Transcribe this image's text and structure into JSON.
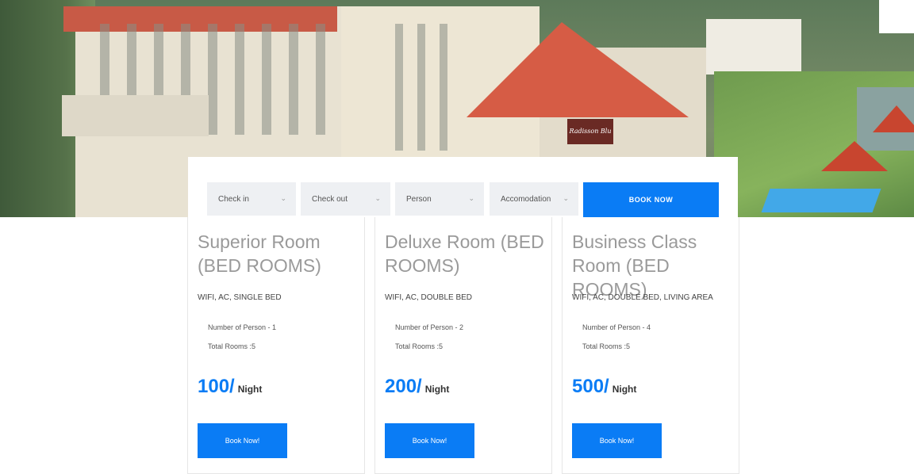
{
  "hero": {
    "sign_text": "Radisson Blu"
  },
  "booking": {
    "fields": [
      {
        "label": "Check in"
      },
      {
        "label": "Check out"
      },
      {
        "label": "Person"
      },
      {
        "label": "Accomodation"
      }
    ],
    "book_now_label": "BOOK NOW"
  },
  "rooms": [
    {
      "title": "Superior Room (BED ROOMS)",
      "features": "WIFI, AC, SINGLE BED",
      "persons": "Number of Person - 1",
      "total_rooms": "Total Rooms :5",
      "price": "100/",
      "price_unit": "Night",
      "button_label": "Book Now!"
    },
    {
      "title": "Deluxe Room (BED ROOMS)",
      "features": "WIFI, AC, DOUBLE BED",
      "persons": "Number of Person - 2",
      "total_rooms": "Total Rooms :5",
      "price": "200/",
      "price_unit": "Night",
      "button_label": "Book Now!"
    },
    {
      "title": "Business Class Room (BED ROOMS)",
      "features": "WIFI, AC, DOUBLE BED, LIVING AREA",
      "persons": "Number of Person - 4",
      "total_rooms": "Total Rooms :5",
      "price": "500/",
      "price_unit": "Night",
      "button_label": "Book Now!"
    }
  ],
  "icons": {
    "dropdown": "chevron-down-icon"
  },
  "colors": {
    "accent": "#0a7cf5",
    "field_bg": "#eef0f3",
    "title_grey": "#9a9a9a"
  }
}
